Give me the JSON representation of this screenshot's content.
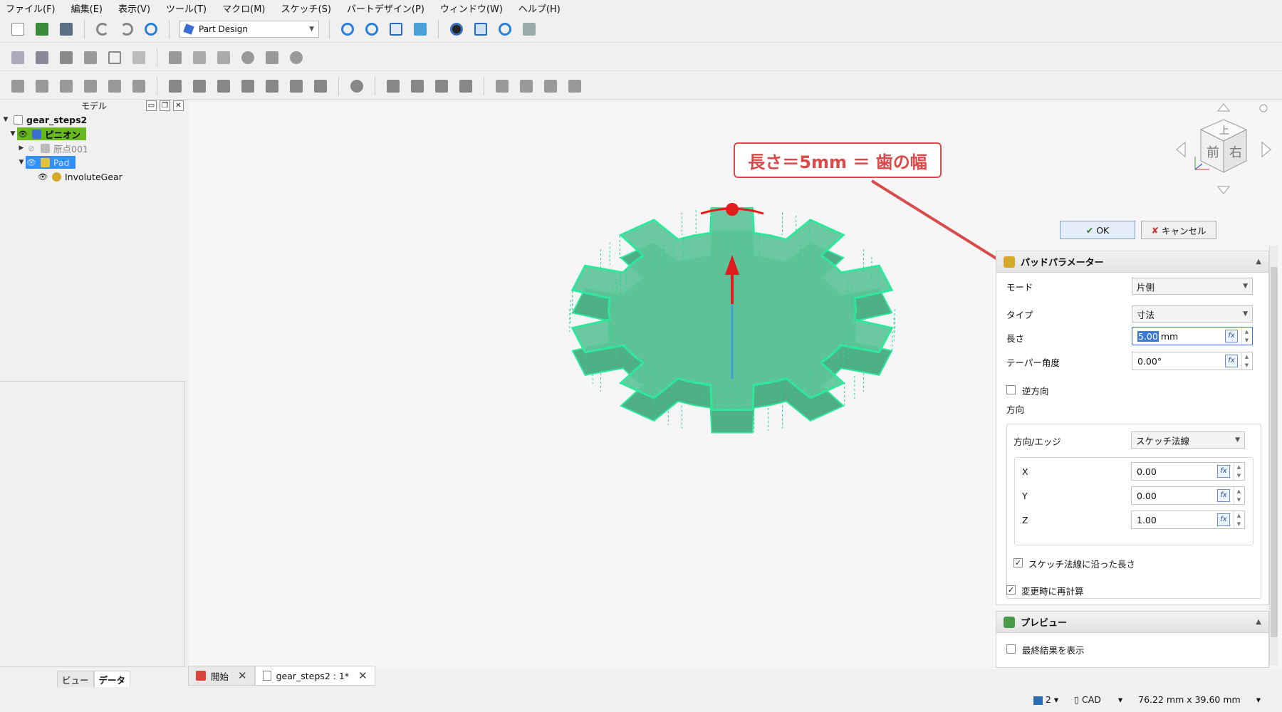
{
  "menu": [
    "ファイル(F)",
    "編集(E)",
    "表示(V)",
    "ツール(T)",
    "マクロ(M)",
    "スケッチ(S)",
    "パートデザイン(P)",
    "ウィンドウ(W)",
    "ヘルプ(H)"
  ],
  "toolbar": {
    "workbench": "Part Design"
  },
  "model_panel": {
    "title": "モデル",
    "tree": [
      {
        "label": "gear_steps2"
      },
      {
        "label": "ピニオン"
      },
      {
        "label": "原点001"
      },
      {
        "label": "Pad"
      },
      {
        "label": "InvoluteGear"
      }
    ],
    "tabs": [
      "ビュー",
      "データ"
    ]
  },
  "annotation": {
    "text": "長さ＝5mm ＝ 歯の幅"
  },
  "task": {
    "ok_label": "OK",
    "cancel_label": "キャンセル",
    "pad_title": "パッドパラメーター",
    "mode_label": "モード",
    "mode_value": "片側",
    "type_label": "タイプ",
    "type_value": "寸法",
    "length_label": "長さ",
    "length_value": "5.00",
    "length_unit": "mm",
    "taper_label": "テーパー角度",
    "taper_value": "0.00°",
    "reverse_label": "逆方向",
    "direction_group": "方向",
    "direction_edge_label": "方向/エッジ",
    "direction_edge_value": "スケッチ法線",
    "x_label": "X",
    "x_value": "0.00",
    "y_label": "Y",
    "y_value": "0.00",
    "z_label": "Z",
    "z_value": "1.00",
    "along_normal_label": "スケッチ法線に沿った長さ",
    "recompute_label": "変更時に再計算",
    "preview_title": "プレビュー",
    "show_final_label": "最終結果を表示",
    "fx": "fx"
  },
  "navcube": {
    "top": "上",
    "front": "前",
    "right": "右"
  },
  "doc_tabs": [
    "開始",
    "gear_steps2 : 1*"
  ],
  "status": {
    "count": "2",
    "nav_style": "CAD",
    "dimensions": "76.22 mm x 39.60 mm"
  },
  "colors": {
    "gear_fill": "#5fc39a",
    "gear_edge": "#2ee89a",
    "selection": "#2f8fff",
    "body_bg": "#69b81e",
    "annotation": "#d94a4a"
  }
}
